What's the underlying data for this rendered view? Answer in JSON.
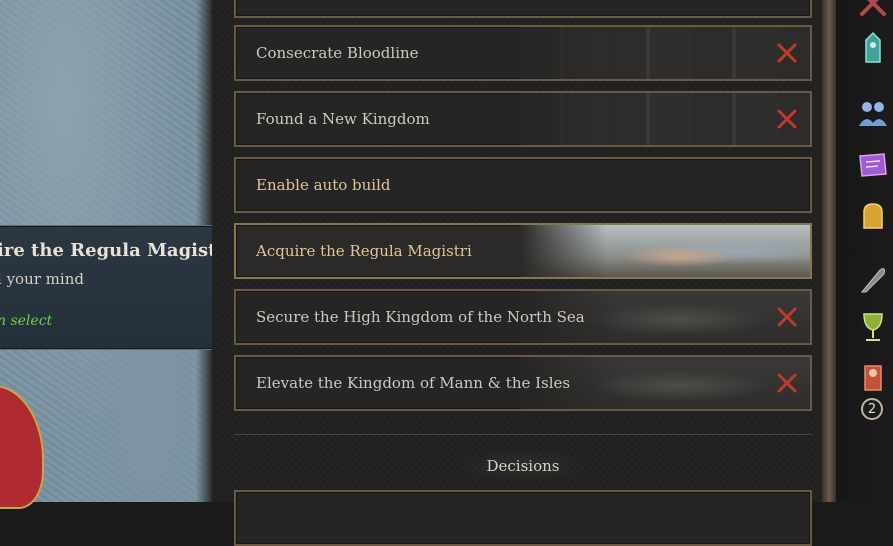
{
  "tooltip": {
    "title": "ire the Regula Magistri",
    "line": "l your mind",
    "hint": "n select"
  },
  "decisions": [
    {
      "label": "Consecrate Bloodline",
      "available": false,
      "art": "carved"
    },
    {
      "label": "Found a New Kingdom",
      "available": false,
      "art": "carved"
    },
    {
      "label": "Enable auto build",
      "available": true,
      "art": "none"
    },
    {
      "label": "Acquire the Regula Magistri",
      "available": true,
      "art": "painting"
    },
    {
      "label": "Secure the High Kingdom of the North Sea",
      "available": false,
      "art": "warriors"
    },
    {
      "label": "Elevate the Kingdom of Mann & the Isles",
      "available": false,
      "art": "warriors"
    }
  ],
  "section": {
    "title": "Decisions"
  },
  "sidebar": {
    "icons": [
      "crossed-swords-icon",
      "tower-icon",
      "council-icon",
      "scroll-icon",
      "fist-icon",
      "quill-icon",
      "goblet-icon",
      "character-icon"
    ],
    "badge_count": "2"
  },
  "colors": {
    "unavailable_x": "#c0392b",
    "available_label": "#e0c49a",
    "hint_green": "#6fcf4e"
  }
}
